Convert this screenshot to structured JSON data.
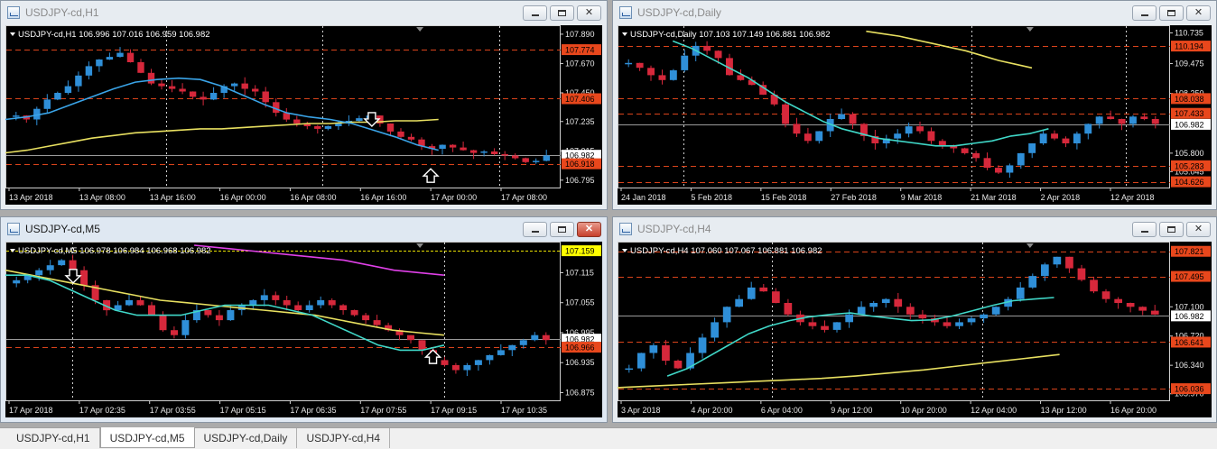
{
  "windows": [
    {
      "id": "h1",
      "title": "USDJPY-cd,H1",
      "active": false,
      "frame": [
        0,
        0,
        673,
        233
      ],
      "info": "USDJPY-cd,H1  106.996 107.016 106.959 106.982",
      "price_labels": [
        "107.890",
        "107.670",
        "107.450",
        "107.235",
        "107.015",
        "106.795"
      ],
      "price_min": 106.76,
      "price_max": 107.93,
      "tags": [
        {
          "text": "107.774",
          "value": 107.774,
          "color": "#e8471c"
        },
        {
          "text": "107.406",
          "value": 107.406,
          "color": "#e8471c"
        },
        {
          "text": "106.982",
          "value": 106.982,
          "color": "#ffffff"
        },
        {
          "text": "106.918",
          "value": 106.918,
          "color": "#e8471c"
        }
      ],
      "time_labels": [
        "13 Apr 2018",
        "13 Apr 08:00",
        "13 Apr 16:00",
        "16 Apr 00:00",
        "16 Apr 08:00",
        "16 Apr 16:00",
        "17 Apr 00:00",
        "17 Apr 08:00"
      ],
      "candles": [
        107.28,
        107.25,
        107.33,
        107.4,
        107.45,
        107.5,
        107.58,
        107.65,
        107.7,
        107.72,
        107.75,
        107.68,
        107.6,
        107.52,
        107.5,
        107.48,
        107.46,
        107.42,
        107.4,
        107.45,
        107.5,
        107.52,
        107.48,
        107.46,
        107.38,
        107.3,
        107.25,
        107.22,
        107.2,
        107.18,
        107.2,
        107.22,
        107.24,
        107.26,
        107.28,
        107.22,
        107.16,
        107.12,
        107.1,
        107.05,
        107.03,
        107.06,
        107.04,
        107.02,
        107.0,
        107.01,
        106.99,
        106.98,
        106.96,
        106.93,
        106.94,
        106.98
      ],
      "ma_blue": [
        107.25,
        107.27,
        107.3,
        107.36,
        107.42,
        107.48,
        107.53,
        107.55,
        107.56,
        107.55,
        107.5,
        107.43,
        107.36,
        107.3,
        107.27,
        107.25,
        107.22,
        107.17,
        107.12,
        107.06,
        107.02
      ],
      "ma_yellow": [
        107.0,
        107.02,
        107.05,
        107.08,
        107.11,
        107.13,
        107.15,
        107.16,
        107.17,
        107.18,
        107.18,
        107.19,
        107.2,
        107.21,
        107.22,
        107.22,
        107.23,
        107.23,
        107.24,
        107.24,
        107.25
      ],
      "vlines": [
        0.29,
        0.57,
        0.89
      ],
      "arrows": [
        {
          "x": 0.66,
          "v": 107.22,
          "dir": "down"
        },
        {
          "x": 0.766,
          "v": 106.86,
          "dir": "up"
        }
      ]
    },
    {
      "id": "daily",
      "title": "USDJPY-cd,Daily",
      "active": false,
      "frame": [
        678,
        0,
        670,
        233
      ],
      "info": "USDJPY-cd,Daily  107.103 107.149 106.881 106.982",
      "price_labels": [
        "110.735",
        "109.475",
        "108.250",
        "105.800",
        "105.045"
      ],
      "price_min": 104.5,
      "price_max": 110.9,
      "tags": [
        {
          "text": "110.194",
          "value": 110.194,
          "color": "#e8471c"
        },
        {
          "text": "108.038",
          "value": 108.038,
          "color": "#e8471c"
        },
        {
          "text": "107.433",
          "value": 107.433,
          "color": "#e8471c"
        },
        {
          "text": "106.982",
          "value": 106.982,
          "color": "#ffffff"
        },
        {
          "text": "105.283",
          "value": 105.283,
          "color": "#e8471c"
        },
        {
          "text": "104.626",
          "value": 104.626,
          "color": "#e8471c"
        }
      ],
      "time_labels": [
        "24 Jan 2018",
        "5 Feb 2018",
        "15 Feb 2018",
        "27 Feb 2018",
        "9 Mar 2018",
        "21 Mar 2018",
        "2 Apr 2018",
        "12 Apr 2018"
      ],
      "candles": [
        109.5,
        109.3,
        109.0,
        108.8,
        109.2,
        109.8,
        110.2,
        110.0,
        109.7,
        109.0,
        108.8,
        108.6,
        108.2,
        107.8,
        107.0,
        106.6,
        106.3,
        106.7,
        107.2,
        107.4,
        107.0,
        106.5,
        106.2,
        106.4,
        106.6,
        106.9,
        106.7,
        106.3,
        106.1,
        106.0,
        105.8,
        105.6,
        105.2,
        105.0,
        105.3,
        105.8,
        106.2,
        106.6,
        106.4,
        106.2,
        106.6,
        107.0,
        107.3,
        107.2,
        107.0,
        107.3,
        107.2,
        107.0
      ],
      "ma_blue": [
        110.4,
        110.1,
        109.7,
        109.3,
        108.9,
        108.4,
        107.9,
        107.5,
        107.1,
        106.8,
        106.6,
        106.4,
        106.3,
        106.2,
        106.1,
        106.1,
        106.2,
        106.3,
        106.5,
        106.6,
        106.8
      ],
      "ma_yellow": [
        110.8,
        110.7,
        110.6,
        110.45,
        110.3,
        110.15,
        110.0,
        109.8,
        109.6,
        109.45,
        109.3
      ],
      "vlines": [
        0.12,
        0.64,
        0.92
      ],
      "arrows": []
    },
    {
      "id": "m5",
      "title": "USDJPY-cd,M5",
      "active": true,
      "frame": [
        0,
        240,
        673,
        229
      ],
      "info": "USDJPY-cd,M5  106.978 106.984 106.968 106.982",
      "price_labels": [
        "107.115",
        "107.055",
        "106.995",
        "106.935",
        "106.875"
      ],
      "price_min": 106.865,
      "price_max": 107.17,
      "tags": [
        {
          "text": "107.159",
          "value": 107.159,
          "color": "#ffff00"
        },
        {
          "text": "106.982",
          "value": 106.982,
          "color": "#ffffff"
        },
        {
          "text": "106.966",
          "value": 106.966,
          "color": "#e8471c"
        }
      ],
      "time_labels": [
        "17 Apr 2018",
        "17 Apr 02:35",
        "17 Apr 03:55",
        "17 Apr 05:15",
        "17 Apr 06:35",
        "17 Apr 07:55",
        "17 Apr 09:15",
        "17 Apr 10:35"
      ],
      "candles": [
        107.1,
        107.11,
        107.12,
        107.13,
        107.14,
        107.12,
        107.09,
        107.06,
        107.04,
        107.05,
        107.06,
        107.05,
        107.03,
        107.0,
        106.99,
        107.02,
        107.04,
        107.03,
        107.02,
        107.04,
        107.05,
        107.06,
        107.07,
        107.06,
        107.05,
        107.04,
        107.05,
        107.06,
        107.05,
        107.04,
        107.03,
        107.02,
        107.01,
        107.0,
        106.99,
        106.98,
        106.96,
        106.94,
        106.93,
        106.92,
        106.93,
        106.94,
        106.95,
        106.96,
        106.97,
        106.98,
        106.99,
        106.98
      ],
      "ma_blue": [
        107.11,
        107.11,
        107.1,
        107.08,
        107.06,
        107.04,
        107.03,
        107.03,
        107.03,
        107.04,
        107.05,
        107.05,
        107.05,
        107.04,
        107.03,
        107.01,
        106.99,
        106.97,
        106.96,
        106.96,
        106.97
      ],
      "ma_yellow": [
        107.12,
        107.11,
        107.1,
        107.09,
        107.08,
        107.07,
        107.06,
        107.055,
        107.05,
        107.045,
        107.04,
        107.035,
        107.03,
        107.02,
        107.01,
        107.0,
        106.995,
        106.99
      ],
      "ma_magenta": [
        107.17,
        107.16,
        107.15,
        107.14,
        107.12,
        107.11
      ],
      "vlines": [
        0.12,
        0.79
      ],
      "arrows": [
        {
          "x": 0.122,
          "v": 107.1,
          "dir": "down"
        },
        {
          "x": 0.77,
          "v": 106.955,
          "dir": "up"
        }
      ]
    },
    {
      "id": "h4",
      "title": "USDJPY-cd,H4",
      "active": false,
      "frame": [
        678,
        240,
        670,
        229
      ],
      "info": "USDJPY-cd,H4  107.060 107.067 106.881 106.982",
      "price_labels": [
        "107.100",
        "106.720",
        "106.340",
        "105.970"
      ],
      "price_min": 105.92,
      "price_max": 107.9,
      "tags": [
        {
          "text": "107.821",
          "value": 107.821,
          "color": "#e8471c"
        },
        {
          "text": "107.495",
          "value": 107.495,
          "color": "#e8471c"
        },
        {
          "text": "106.982",
          "value": 106.982,
          "color": "#ffffff"
        },
        {
          "text": "106.641",
          "value": 106.641,
          "color": "#e8471c"
        },
        {
          "text": "106.036",
          "value": 106.036,
          "color": "#e8471c"
        }
      ],
      "time_labels": [
        "3 Apr 2018",
        "4 Apr 20:00",
        "6 Apr 04:00",
        "9 Apr 12:00",
        "10 Apr 20:00",
        "12 Apr 04:00",
        "13 Apr 12:00",
        "16 Apr 20:00"
      ],
      "candles": [
        106.3,
        106.5,
        106.6,
        106.4,
        106.3,
        106.5,
        106.7,
        106.9,
        107.1,
        107.2,
        107.35,
        107.3,
        107.15,
        107.0,
        106.9,
        106.85,
        106.8,
        106.9,
        107.0,
        107.1,
        107.15,
        107.2,
        107.1,
        107.0,
        106.95,
        106.9,
        106.85,
        106.9,
        106.95,
        107.0,
        107.1,
        107.2,
        107.35,
        107.5,
        107.65,
        107.75,
        107.6,
        107.45,
        107.3,
        107.2,
        107.15,
        107.1,
        107.05,
        107.0
      ],
      "ma_blue": [
        106.2,
        106.3,
        106.45,
        106.6,
        106.75,
        106.85,
        106.92,
        106.97,
        107.0,
        107.02,
        106.98,
        106.95,
        106.92,
        106.93,
        106.98,
        107.05,
        107.12,
        107.18,
        107.2,
        107.22
      ],
      "ma_yellow": [
        106.05,
        106.07,
        106.09,
        106.11,
        106.13,
        106.15,
        106.17,
        106.2,
        106.24,
        106.28,
        106.33,
        106.38,
        106.43,
        106.48
      ],
      "vlines": [
        0.28,
        0.66
      ],
      "arrows": []
    }
  ],
  "tabs": [
    {
      "label": "USDJPY-cd,H1",
      "active": false
    },
    {
      "label": "USDJPY-cd,M5",
      "active": true
    },
    {
      "label": "USDJPY-cd,Daily",
      "active": false
    },
    {
      "label": "USDJPY-cd,H4",
      "active": false
    }
  ],
  "colors": {
    "bull": "#2f8fd8",
    "bear": "#d6283b",
    "ma_blue": "#3aa4e8",
    "ma_cyan": "#40d8c8",
    "ma_yellow": "#e8e060",
    "ma_magenta": "#e040e8",
    "grid": "#4a4a4a",
    "level": "#d9431b"
  }
}
